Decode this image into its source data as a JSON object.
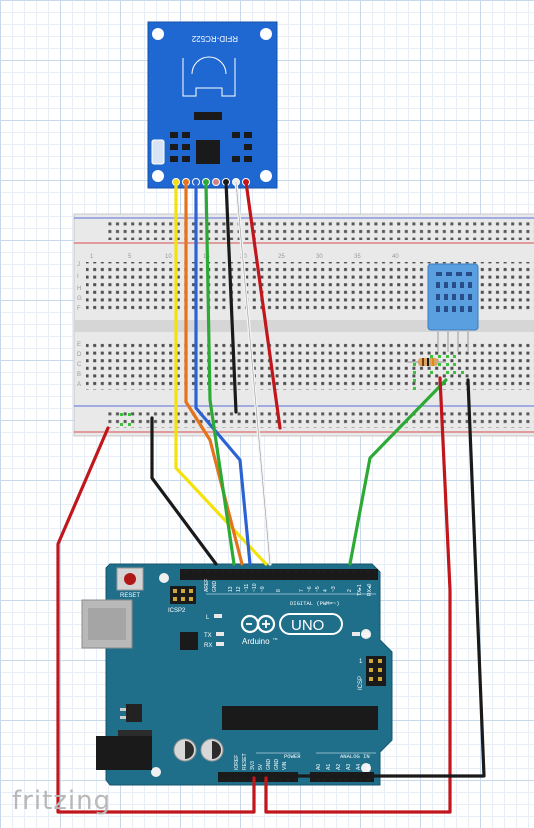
{
  "rfid_module": {
    "label": "RFID-RC522"
  },
  "arduino": {
    "logo_text": "Arduino",
    "trademark": "TM",
    "model_badge": "UNO",
    "reset_label": "RESET",
    "icsp2_label": "ICSP2",
    "icsp_label": "ICSP",
    "led_l_label": "L",
    "led_tx_label": "TX",
    "led_rx_label": "RX",
    "led_on_label": "ON",
    "icsp_pin1_label": "1",
    "digital_header_label": "DIGITAL (PWM=~)",
    "power_header_label": "POWER",
    "analog_header_label": "ANALOG IN",
    "digital_pins": [
      "AREF",
      "GND",
      "13",
      "12",
      "~11",
      "~10",
      "~9",
      "8",
      "7",
      "~6",
      "~5",
      "4",
      "~3",
      "2",
      "TX▸1",
      "RX◂0"
    ],
    "power_pins": [
      "IOREF",
      "RESET",
      "3V3",
      "5V",
      "GND",
      "GND",
      "VIN"
    ],
    "analog_pins": [
      "A0",
      "A1",
      "A2",
      "A3",
      "A4",
      "A5"
    ]
  },
  "breadboard": {
    "row_labels_top": [
      "J",
      "I",
      "H",
      "G",
      "F"
    ],
    "row_labels_bottom": [
      "E",
      "D",
      "C",
      "B",
      "A"
    ],
    "column_numbers": [
      "1",
      "5",
      "10",
      "15",
      "20",
      "25",
      "30",
      "35",
      "40"
    ]
  },
  "wire_colors": {
    "red": "#c1161c",
    "black": "#1a1a1a",
    "yellow": "#f4e20c",
    "orange": "#e4731b",
    "green": "#2daa36",
    "blue": "#2b63d4",
    "white": "#e8e8e8"
  },
  "watermark": "fritzing"
}
